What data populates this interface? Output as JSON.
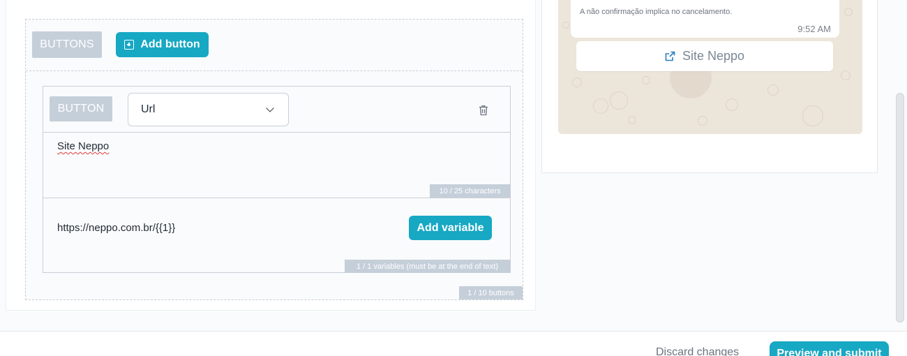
{
  "buttons_section": {
    "tag": "BUTTONS",
    "add_button_label": "Add button",
    "counter": "1 / 10 buttons"
  },
  "button_item": {
    "tag": "BUTTON",
    "type_select_value": "Url",
    "text_value": "Site Neppo",
    "text_counter": "10 / 25 characters",
    "url_value": "https://neppo.com.br/{{1}}",
    "add_variable_label": "Add variable",
    "variables_counter": "1 / 1 variables (must be at the end of text)"
  },
  "preview": {
    "bubble_text": "A não confirmação implica no cancelamento.",
    "bubble_time": "9:52 AM",
    "link_button_label": "Site Neppo"
  },
  "footer": {
    "discard_label": "Discard changes",
    "submit_label": "Preview and submit"
  },
  "colors": {
    "accent": "#17a8c4",
    "tag_bg": "#c5cfda",
    "chat_bg": "#ece5da"
  },
  "icons": [
    "plus-square-icon",
    "chevron-down-icon",
    "trash-icon",
    "external-link-icon"
  ]
}
